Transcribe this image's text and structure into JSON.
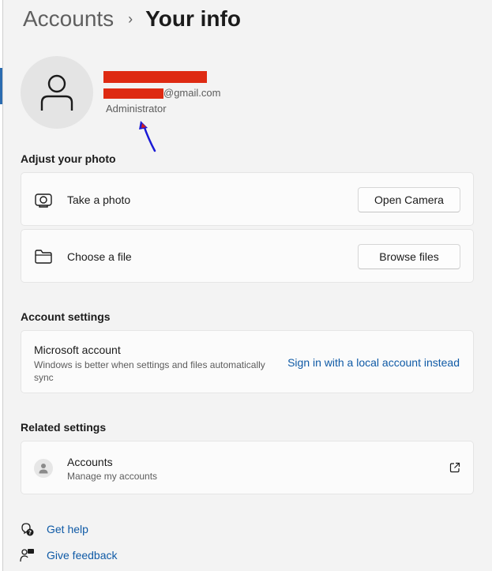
{
  "breadcrumb": {
    "parent": "Accounts",
    "separator": "›",
    "current": "Your info"
  },
  "profile": {
    "avatar_icon": "person-icon",
    "email_suffix": "@gmail.com",
    "role": "Administrator",
    "redaction_color": "#de2a12"
  },
  "adjust_photo": {
    "title": "Adjust your photo",
    "take_photo": {
      "icon": "camera-icon",
      "label": "Take a photo",
      "button": "Open Camera"
    },
    "choose_file": {
      "icon": "folder-icon",
      "label": "Choose a file",
      "button": "Browse files"
    }
  },
  "account_settings": {
    "title": "Account settings",
    "microsoft_account": {
      "title": "Microsoft account",
      "description": "Windows is better when settings and files automatically sync",
      "link": "Sign in with a local account instead"
    }
  },
  "related_settings": {
    "title": "Related settings",
    "accounts": {
      "icon": "person-icon",
      "title": "Accounts",
      "subtitle": "Manage my accounts",
      "action_icon": "open-external-icon"
    }
  },
  "footer": {
    "help": {
      "icon": "help-chat-icon",
      "label": "Get help"
    },
    "feedback": {
      "icon": "feedback-icon",
      "label": "Give feedback"
    }
  },
  "colors": {
    "accent_link": "#0f5aa6",
    "annotation_arrow": "#1a1ad6"
  }
}
